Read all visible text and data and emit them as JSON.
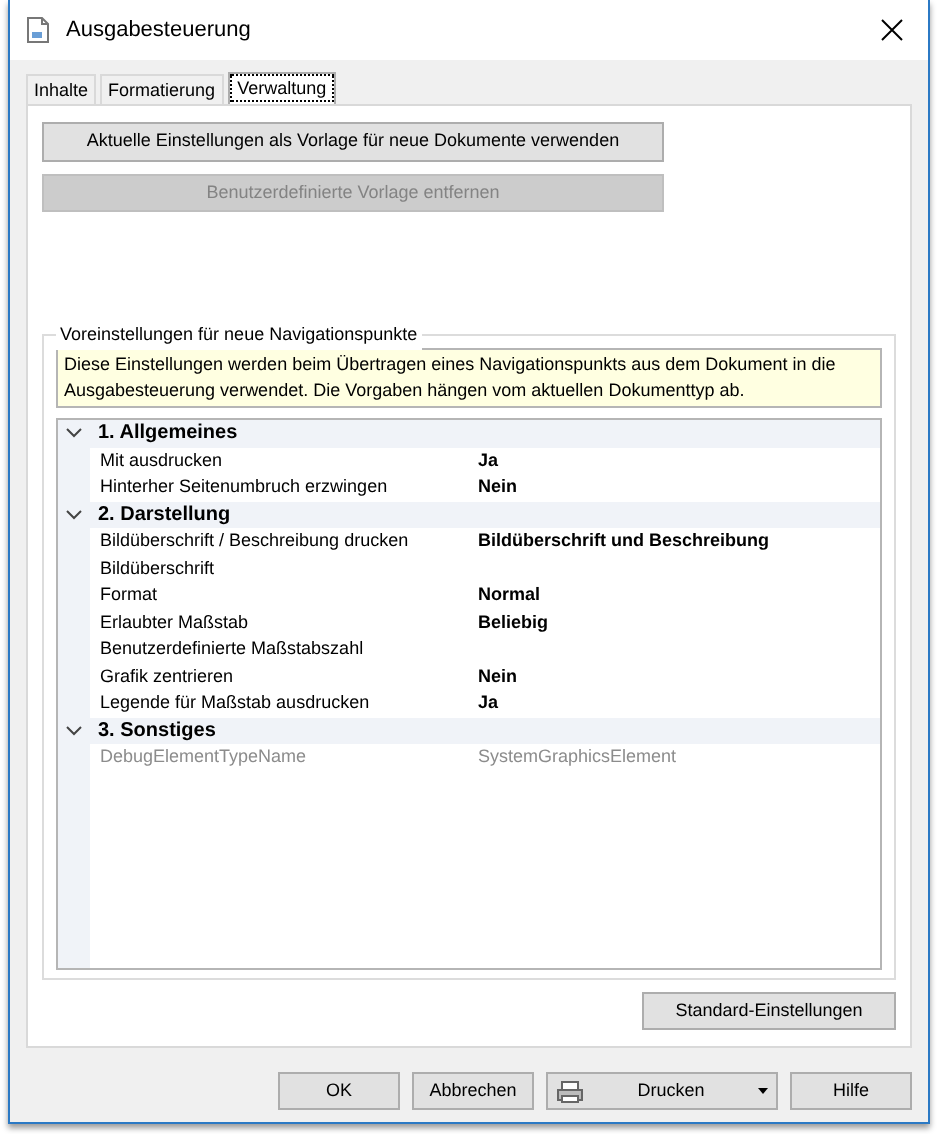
{
  "window": {
    "title": "Ausgabesteuerung"
  },
  "tabs": [
    {
      "label": "Inhalte",
      "selected": false
    },
    {
      "label": "Formatierung",
      "selected": false
    },
    {
      "label": "Verwaltung",
      "selected": true
    }
  ],
  "actions": [
    {
      "label": "Aktuelle Einstellungen als Vorlage für neue Dokumente verwenden",
      "disabled": false
    },
    {
      "label": "Benutzerdefinierte Vorlage entfernen",
      "disabled": true
    }
  ],
  "group": {
    "title": "Voreinstellungen für neue Navigationspunkte",
    "info": "Diese Einstellungen werden beim Übertragen eines Navigationspunkts aus dem Dokument in die Ausgabesteuerung verwendet. Die Vorgaben hängen vom aktuellen Dokumenttyp ab.",
    "categories": [
      {
        "title": "1. Allgemeines",
        "expanded": true,
        "properties": [
          {
            "name": "Mit ausdrucken",
            "value": "Ja",
            "disabled": false
          },
          {
            "name": "Hinterher Seitenumbruch erzwingen",
            "value": "Nein",
            "disabled": false
          }
        ]
      },
      {
        "title": "2. Darstellung",
        "expanded": true,
        "properties": [
          {
            "name": "Bildüberschrift / Beschreibung drucken",
            "value": "Bildüberschrift und Beschreibung",
            "disabled": false
          },
          {
            "name": "Bildüberschrift",
            "disabled": false
          },
          {
            "name": "Format",
            "value": "Normal",
            "disabled": false
          },
          {
            "name": "Erlaubter Maßstab",
            "value": "Beliebig",
            "disabled": false
          },
          {
            "name": "Benutzerdefinierte Maßstabszahl",
            "disabled": false
          },
          {
            "name": "Grafik zentrieren",
            "value": "Nein",
            "disabled": false
          },
          {
            "name": "Legende für Maßstab ausdrucken",
            "value": "Ja",
            "disabled": false
          }
        ]
      },
      {
        "title": "3. Sonstiges",
        "expanded": true,
        "properties": [
          {
            "name": "DebugElementTypeName",
            "value": "SystemGraphicsElement",
            "disabled": true
          }
        ]
      }
    ],
    "reset_button": "Standard-Einstellungen"
  },
  "footer": [
    {
      "label": "OK",
      "kind": "plain"
    },
    {
      "label": "Abbrechen",
      "kind": "plain"
    },
    {
      "label": "Drucken",
      "kind": "print"
    },
    {
      "label": "Hilfe",
      "kind": "plain"
    }
  ]
}
